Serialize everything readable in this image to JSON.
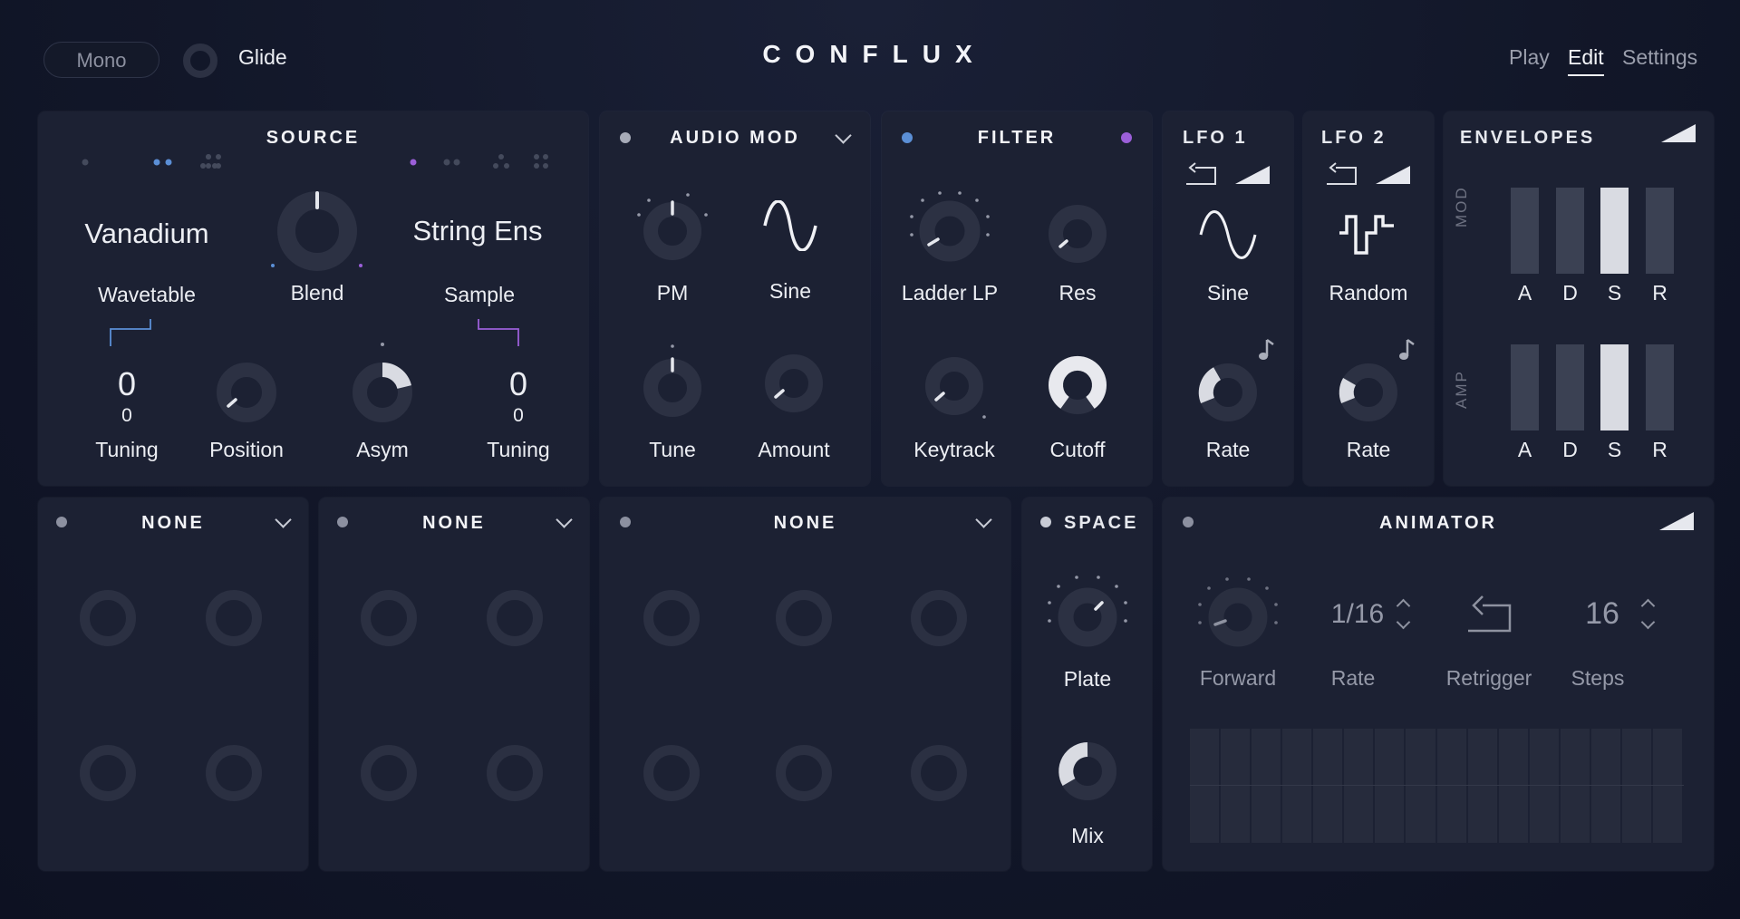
{
  "header": {
    "mono_label": "Mono",
    "glide_label": "Glide",
    "logo": "CONFLUX",
    "tabs": [
      {
        "label": "Play",
        "active": false
      },
      {
        "label": "Edit",
        "active": true
      },
      {
        "label": "Settings",
        "active": false
      }
    ]
  },
  "source": {
    "title": "SOURCE",
    "left_name": "Vanadium",
    "left_type": "Wavetable",
    "right_name": "String Ens",
    "right_type": "Sample",
    "blend_label": "Blend",
    "left_tuning_value": "0",
    "left_tuning_sub": "0",
    "left_tuning_label": "Tuning",
    "position_label": "Position",
    "asym_label": "Asym",
    "right_tuning_value": "0",
    "right_tuning_sub": "0",
    "right_tuning_label": "Tuning",
    "accent_left": "#5b8fd6",
    "accent_right": "#9b5fd9"
  },
  "audio_mod": {
    "title": "AUDIO MOD",
    "pm_label": "PM",
    "wave_label": "Sine",
    "tune_label": "Tune",
    "amount_label": "Amount"
  },
  "filter": {
    "title": "FILTER",
    "type_label": "Ladder LP",
    "res_label": "Res",
    "keytrack_label": "Keytrack",
    "cutoff_label": "Cutoff"
  },
  "lfo1": {
    "title": "LFO 1",
    "wave_label": "Sine",
    "rate_label": "Rate"
  },
  "lfo2": {
    "title": "LFO 2",
    "wave_label": "Random",
    "rate_label": "Rate"
  },
  "envelopes": {
    "title": "ENVELOPES",
    "mod_label": "MOD",
    "amp_label": "AMP",
    "stages": [
      "A",
      "D",
      "S",
      "R"
    ]
  },
  "fx": [
    {
      "title": "NONE"
    },
    {
      "title": "NONE"
    },
    {
      "title": "NONE"
    }
  ],
  "space": {
    "title": "SPACE",
    "type_label": "Plate",
    "mix_label": "Mix"
  },
  "animator": {
    "title": "ANIMATOR",
    "direction_label": "Forward",
    "rate_value": "1/16",
    "rate_label": "Rate",
    "retrigger_label": "Retrigger",
    "steps_value": "16",
    "steps_label": "Steps"
  }
}
